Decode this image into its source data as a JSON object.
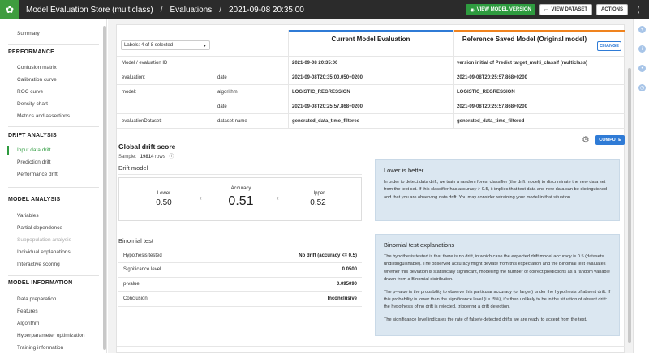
{
  "header": {
    "title": "Model Evaluation Store (multiclass)",
    "section": "Evaluations",
    "evaluation": "2021-09-08 20:35:00",
    "view_model_label": "VIEW MODEL VERSION",
    "view_dataset_label": "VIEW DATASET",
    "actions_label": "ACTIONS"
  },
  "sidebar": {
    "summary": "Summary",
    "performance": {
      "heading": "PERFORMANCE",
      "items": [
        "Confusion matrix",
        "Calibration curve",
        "ROC curve",
        "Density chart",
        "Metrics and assertions"
      ]
    },
    "drift": {
      "heading": "DRIFT ANALYSIS",
      "items": [
        "Input data drift",
        "Prediction drift",
        "Performance drift"
      ],
      "active": "Input data drift"
    },
    "model_analysis": {
      "heading": "MODEL ANALYSIS",
      "items": [
        "Variables",
        "Partial dependence",
        "Subpopulation analysis",
        "Individual explanations",
        "Interactive scoring"
      ]
    },
    "model_info": {
      "heading": "MODEL INFORMATION",
      "items": [
        "Data preparation",
        "Features",
        "Algorithm",
        "Hyperparameter optimization",
        "Training information"
      ]
    }
  },
  "comparison": {
    "labels_select": "Labels: 4 of 8 selected",
    "current_title": "Current Model Evaluation",
    "reference_title": "Reference Saved Model (Original model)",
    "change_label": "CHANGE",
    "rows": [
      {
        "key": "Model / evaluation ID",
        "sub": "",
        "current": "2021-09-08 20:35:00",
        "reference": "version initial of Predict target_multi_classif (multiclass)"
      },
      {
        "key": "evaluation:",
        "sub": "date",
        "current": "2021-09-08T20:35:00.050+0200",
        "reference": "2021-09-08T20:25:57.868+0200"
      },
      {
        "key": "model:",
        "sub": "algorithm",
        "current": "LOGISTIC_REGRESSION",
        "reference": "LOGISTIC_REGRESSION"
      },
      {
        "key": "",
        "sub": "date",
        "current": "2021-09-08T20:25:57.868+0200",
        "reference": "2021-09-08T20:25:57.868+0200"
      },
      {
        "key": "evaluationDataset:",
        "sub": "dataset-name",
        "current": "generated_data_time_filtered",
        "reference": "generated_data_time_filtered"
      }
    ]
  },
  "drift": {
    "compute_label": "COMPUTE",
    "title": "Global drift score",
    "sample_label": "Sample:",
    "sample_value": "19814",
    "sample_unit": "rows",
    "drift_model_title": "Drift model",
    "lower_label": "Lower",
    "lower_value": "0.50",
    "accuracy_label": "Accuracy",
    "accuracy_value": "0.51",
    "upper_label": "Upper",
    "upper_value": "0.52",
    "binomial_title": "Binomial test",
    "binomial_rows": [
      {
        "k": "Hypothesis tested",
        "v": "No drift (accuracy <= 0.5)",
        "bold": true
      },
      {
        "k": "Significance level",
        "v": "0.0500",
        "bold": true
      },
      {
        "k": "p-value",
        "v": "0.095090",
        "bold": true
      },
      {
        "k": "Conclusion",
        "v": "Inconclusive",
        "bold": true
      }
    ],
    "lower_is_better": {
      "title": "Lower is better",
      "text": "In order to detect data drift, we train a random forest classifier (the drift model) to discriminate the new data set from the test set. If this classifier has accuracy > 0.5, it implies that test data and new data can be distinguished and that you are observing data drift. You may consider retraining your model in that situation."
    },
    "binomial_explanations": {
      "title": "Binomial test explanations",
      "p1": "The hypothesis tested is that there is no drift, in which case the expected drift model accuracy is 0.5 (datasets undistinguishable). The observed accuracy might deviate from this expectation and the Binomial test evaluates whether this deviation is statistically significant, modelling the number of correct predictions as a random variable drawn from a Binomial distribution.",
      "p2": "The p-value is the probability to observe this particular accuracy (or larger) under the hypothesis of absent drift. If this probability is lower than the significance level (i.e. 5%), it's then unlikely to be in the situation of absent drift: the hypothesis of no drift is rejected, triggering a drift detection.",
      "p3": "The significance level indicates the rate of falsely-detected drifts we are ready to accept from the test."
    }
  }
}
